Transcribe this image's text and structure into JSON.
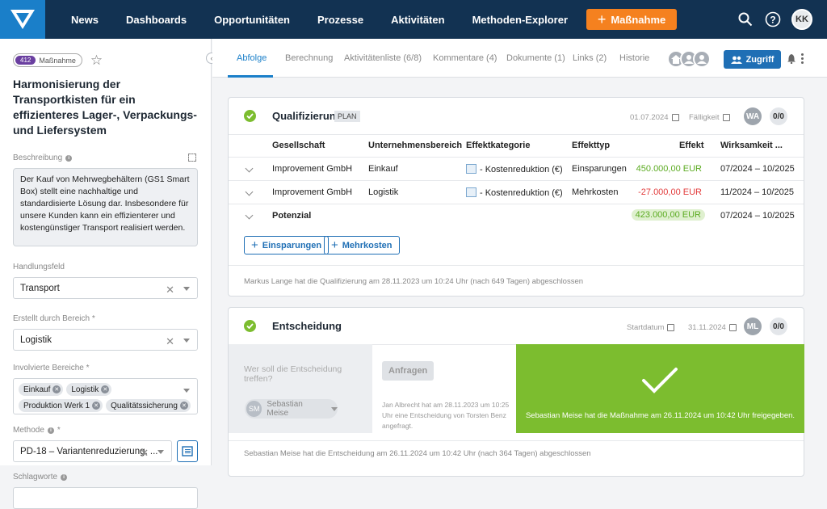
{
  "topnav": {
    "items": [
      "News",
      "Dashboards",
      "Opportunitäten",
      "Prozesse",
      "Aktivitäten",
      "Methoden-Explorer"
    ],
    "cta_label": "Maßnahme",
    "user_initials": "KK",
    "accent_color": "#f5811f",
    "bg_color": "#123252"
  },
  "left": {
    "badge_number": "412",
    "badge_label": "Maßnahme",
    "title": "Harmonisierung der Transportkisten für ein effizienteres Lager-, Verpackungs- und Liefersystem",
    "beschreibung_label": "Beschreibung",
    "beschreibung_text": "Der Kauf von Mehrwegbehältern (GS1 Smart Box) stellt eine nachhaltige und standardisierte Lösung dar. Insbesondere für unsere Kunden kann ein effizienterer und kostengünstiger Transport realisiert werden.",
    "handlungsfeld_label": "Handlungsfeld",
    "handlungsfeld_value": "Transport",
    "erstellt_label": "Erstellt durch Bereich *",
    "erstellt_value": "Logistik",
    "involvierte_label": "Involvierte Bereiche *",
    "involvierte_tags": [
      "Einkauf",
      "Logistik",
      "Produktion Werk 1",
      "Qualitätssicherung"
    ],
    "methode_label": "Methode",
    "methode_star": "*",
    "methode_value": "PD-18 – Variantenreduzierung, ...",
    "schlagworte_label": "Schlagworte"
  },
  "tabs": [
    "Abfolge",
    "Berechnung",
    "Aktivitätenliste (6/8)",
    "Kommentare (4)",
    "Dokumente (1)",
    "Links (2)",
    "Historie"
  ],
  "zugriff_label": "Zugriff",
  "qualifizierung": {
    "title": "Qualifizierung",
    "badge": "PLAN",
    "date": "01.07.2024",
    "faelligkeit_label": "Fälligkeit",
    "assignee": "WA",
    "counter": "0/0",
    "headers": [
      "Gesellschaft",
      "Unternehmensbereich",
      "Effektkategorie",
      "Effekttyp",
      "Effekt",
      "Wirksamkeit ..."
    ],
    "rows": [
      {
        "gesellschaft": "Improvement GmbH",
        "bereich": "Einkauf",
        "kategorie": "- Kostenreduktion (€)",
        "typ": "Einsparungen",
        "effekt": "450.000,00 EUR",
        "wirksamkeit": "07/2024 – 10/2025"
      },
      {
        "gesellschaft": "Improvement GmbH",
        "bereich": "Logistik",
        "kategorie": "- Kostenreduktion (€)",
        "typ": "Mehrkosten",
        "effekt": "-27.000,00 EUR",
        "wirksamkeit": "11/2024 – 10/2025"
      }
    ],
    "potenzial_label": "Potenzial",
    "potenzial_value": "423.000,00 EUR",
    "potenzial_range": "07/2024 – 10/2025",
    "btn_einsparungen": "Einsparungen",
    "btn_mehrkosten": "Mehrkosten",
    "footnote": "Markus Lange hat die Qualifizierung am 28.11.2023 um 10:24 Uhr (nach 649 Tagen) abgeschlossen"
  },
  "entscheidung": {
    "title": "Entscheidung",
    "startdatum_label": "Startdatum",
    "date": "31.11.2024",
    "assignee": "ML",
    "counter": "0/0",
    "question": "Wer soll die Entscheidung treffen?",
    "person_initials": "SM",
    "person_name": "Sebastian Meise",
    "anfragen_label": "Anfragen",
    "request_note": "Jan Albrecht hat am 28.11.2023 um 10:25 Uhr eine Entscheidung von Torsten Benz angefragt.",
    "approved_text": "Sebastian Meise hat die Maßnahme am 26.11.2024 um 10:42 Uhr freigegeben.",
    "footnote": "Sebastian Meise hat die Entscheidung am 26.11.2024 um 10:42 Uhr (nach 364 Tagen) abgeschlossen"
  }
}
